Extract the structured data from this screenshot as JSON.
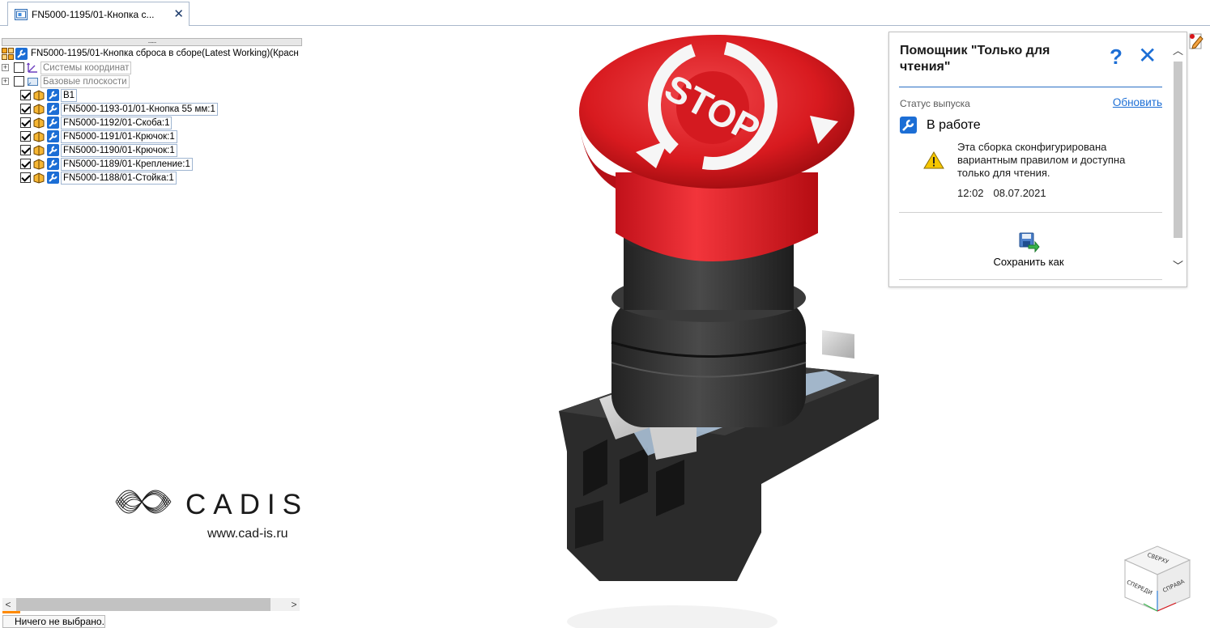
{
  "tab": {
    "title": "FN5000-1195/01-Кнопка с...",
    "close_glyph": "✕"
  },
  "tree": {
    "handle": "........",
    "root_label": "FN5000-1195/01-Кнопка сброса в сборе(Latest Working)(Красн",
    "items": [
      {
        "label": "Системы координат",
        "expandable": true,
        "checked": false,
        "gray": true
      },
      {
        "label": "Базовые плоскости",
        "expandable": true,
        "checked": false,
        "gray": true
      },
      {
        "label": "B1",
        "expandable": false,
        "checked": true,
        "gray": false
      },
      {
        "label": "FN5000-1193-01/01-Кнопка 55 мм:1",
        "expandable": false,
        "checked": true,
        "gray": false
      },
      {
        "label": "FN5000-1192/01-Скоба:1",
        "expandable": false,
        "checked": true,
        "gray": false
      },
      {
        "label": "FN5000-1191/01-Крючок:1",
        "expandable": false,
        "checked": true,
        "gray": false
      },
      {
        "label": "FN5000-1190/01-Крючок:1",
        "expandable": false,
        "checked": true,
        "gray": false
      },
      {
        "label": "FN5000-1189/01-Крепление:1",
        "expandable": false,
        "checked": true,
        "gray": false
      },
      {
        "label": "FN5000-1188/01-Стойка:1",
        "expandable": false,
        "checked": true,
        "gray": false
      }
    ]
  },
  "logo": {
    "brand": "CADIS",
    "url": "www.cad-is.ru"
  },
  "model": {
    "cap_text": "STOP"
  },
  "scroll": {
    "left_arrow": "<",
    "right_arrow": ">"
  },
  "status_bar": {
    "text": "Ничего не выбрано."
  },
  "assistant": {
    "title": "Помощник \"Только для чтения\"",
    "help_glyph": "?",
    "close_glyph": "✕",
    "release_status_label": "Статус выпуска",
    "refresh_link": "Обновить",
    "state": "В работе",
    "message": "Эта сборка сконфигурирована вариантным правилом и доступна только для чтения.",
    "time": "12:02",
    "date": "08.07.2021",
    "save_as": "Сохранить как"
  },
  "viewcube": {
    "top": "СВЕРХУ",
    "front": "СПЕРЕДИ",
    "right": "СПРАВА"
  },
  "colors": {
    "accent_blue": "#1c6ed5",
    "stop_red": "#d9151b",
    "warning_yellow": "#f6c600",
    "progress_orange": "#ff8a00"
  }
}
